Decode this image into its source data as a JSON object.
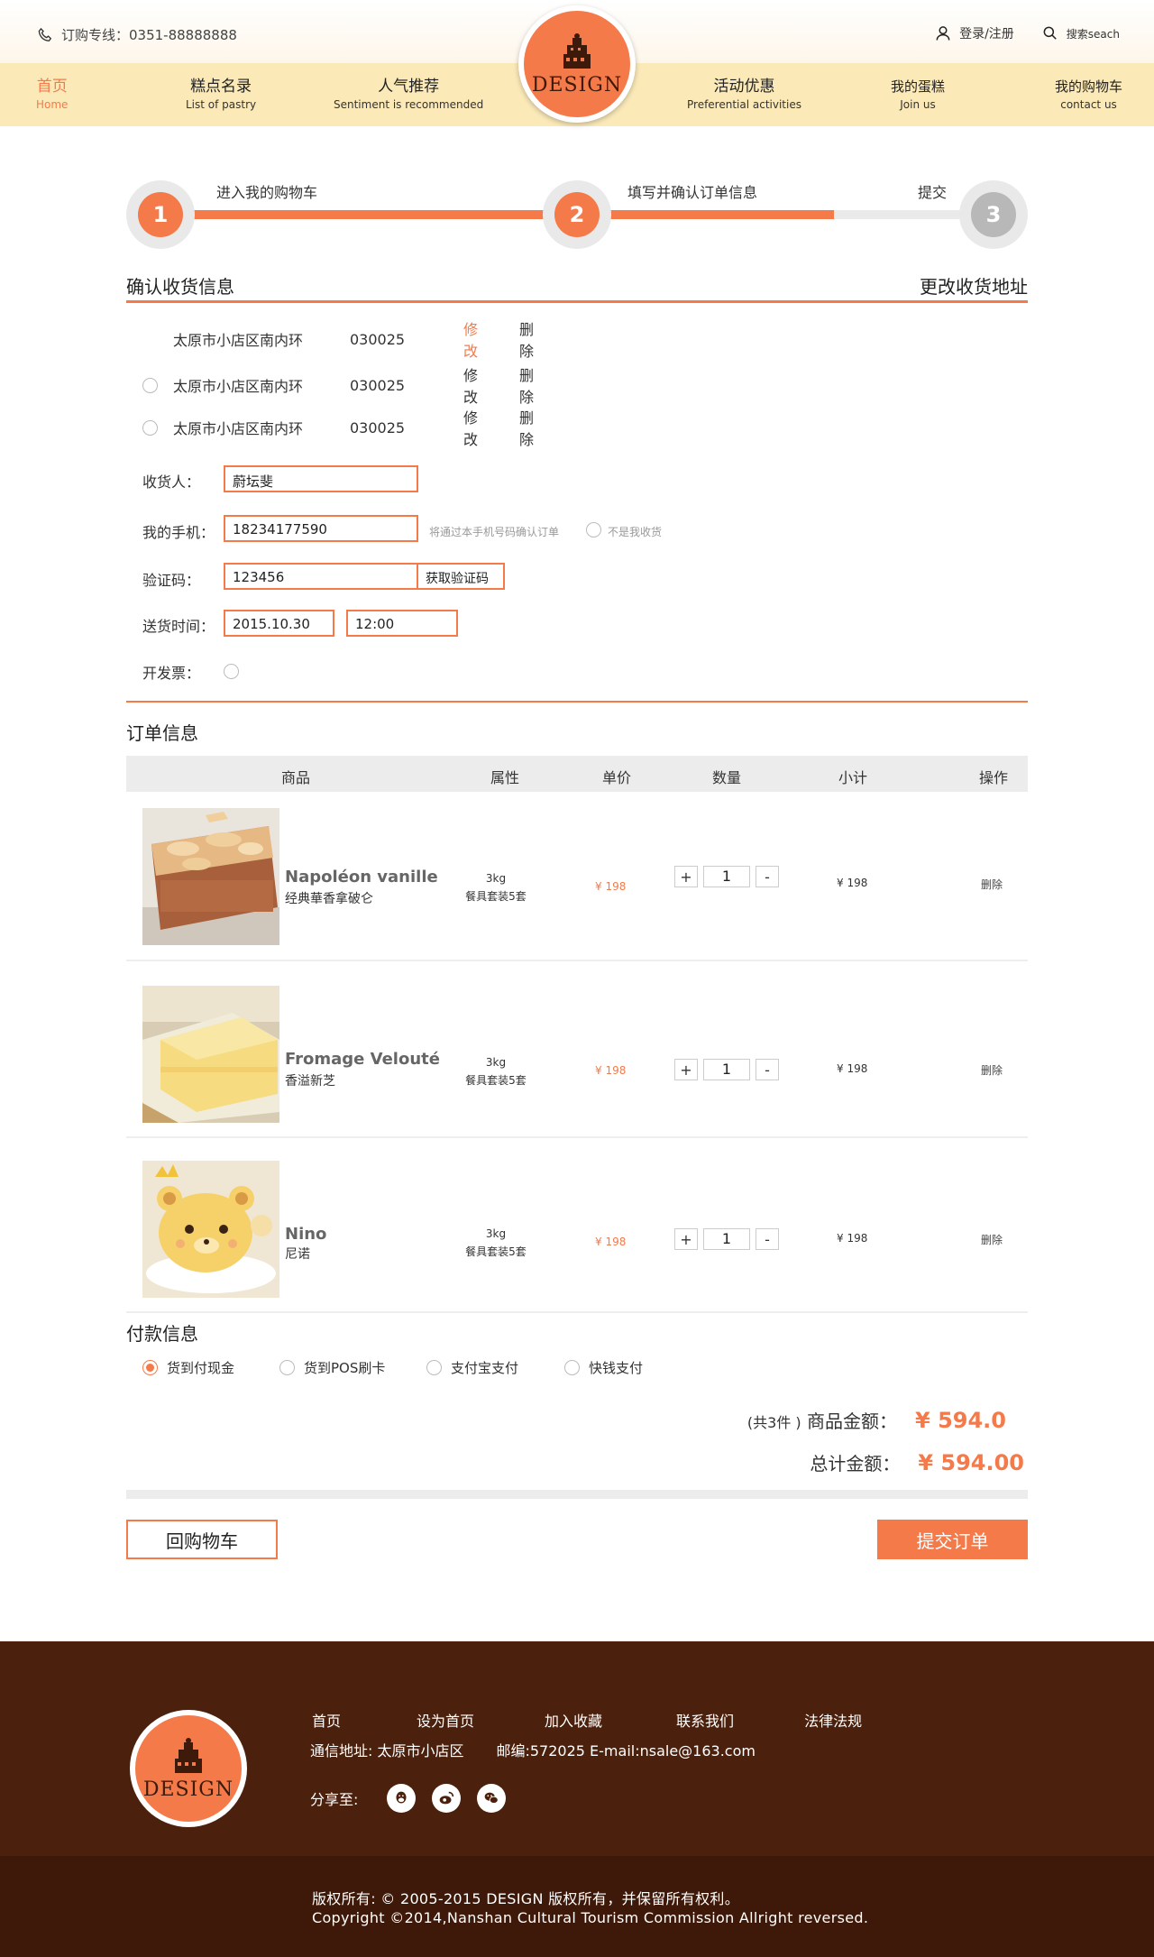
{
  "header": {
    "hotline": "订购专线：0351-88888888",
    "login_label": "登录/注册",
    "search_label": "搜索seach",
    "logo_text": "DESIGN",
    "nav": [
      {
        "cn": "首页",
        "en": "Home"
      },
      {
        "cn": "糕点名录",
        "en": "List of pastry"
      },
      {
        "cn": "人气推荐",
        "en": "Sentiment is recommended"
      },
      {
        "cn": "活动优惠",
        "en": "Preferential activities"
      },
      {
        "cn": "我的蛋糕",
        "en": "Join us"
      },
      {
        "cn": "我的购物车",
        "en": "contact us"
      }
    ]
  },
  "steps": [
    {
      "num": "1",
      "label": "进入我的购物车"
    },
    {
      "num": "2",
      "label": "填写并确认订单信息"
    },
    {
      "num": "3",
      "label": "提交"
    }
  ],
  "shipping": {
    "title": "确认收货信息",
    "change_link": "更改收货地址",
    "addresses": [
      {
        "address": "太原市小店区南内环",
        "zip": "030025",
        "edit": "修改",
        "delete": "删除"
      },
      {
        "address": "太原市小店区南内环",
        "zip": "030025",
        "edit": "修改",
        "delete": "删除"
      },
      {
        "address": "太原市小店区南内环",
        "zip": "030025",
        "edit": "修改",
        "delete": "删除"
      }
    ]
  },
  "form": {
    "receiver_label": "收货人：",
    "receiver_value": "蔚坛斐",
    "phone_label": "我的手机：",
    "phone_value": "18234177590",
    "phone_hint": "将通过本手机号码确认订单",
    "not_me_label": "不是我收货",
    "code_label": "验证码：",
    "code_value": "123456",
    "code_button": "获取验证码",
    "time_label": "送货时间：",
    "date_value": "2015.10.30",
    "time_value": "12:00",
    "invoice_label": "开发票："
  },
  "order": {
    "title": "订单信息",
    "columns": [
      "商品",
      "属性",
      "单价",
      "数量",
      "小计",
      "操作"
    ],
    "items": [
      {
        "name_en": "Napoléon vanille",
        "name_cn": "经典華香拿破仑",
        "attr_weight": "3kg",
        "attr_set": "餐具套装5套",
        "price": "¥ 198",
        "qty": "1",
        "subtotal": "¥ 198",
        "delete": "删除",
        "image": "napoleon-cake-image"
      },
      {
        "name_en": "Fromage Velouté",
        "name_cn": "香溢新芝",
        "attr_weight": "3kg",
        "attr_set": "餐具套装5套",
        "price": "¥ 198",
        "qty": "1",
        "subtotal": "¥ 198",
        "delete": "删除",
        "image": "cheese-cake-image"
      },
      {
        "name_en": "Nino",
        "name_cn": "尼诺",
        "attr_weight": "3kg",
        "attr_set": "餐具套装5套",
        "price": "¥ 198",
        "qty": "1",
        "subtotal": "¥ 198",
        "delete": "删除",
        "image": "bear-cake-image"
      }
    ]
  },
  "payment": {
    "title": "付款信息",
    "options": [
      "货到付现金",
      "货到POS刷卡",
      "支付宝支付",
      "快钱支付"
    ],
    "selected_index": 0,
    "count_text": "(共3件 )",
    "goods_label": "商品金额：",
    "goods_amount": "¥ 594.0",
    "total_label": "总计金额：",
    "total_amount": "¥ 594.00",
    "back_button": "回购物车",
    "submit_button": "提交订单"
  },
  "footer": {
    "links": [
      "首页",
      "设为首页",
      "加入收藏",
      "联系我们",
      "法律法规"
    ],
    "address": "通信地址: 太原市小店区",
    "postal": "邮编:572025 E-mail:nsale@163.com",
    "share_label": "分享至:",
    "share_icons": [
      "qq-icon",
      "weibo-icon",
      "wechat-icon"
    ],
    "copyright_cn": "版权所有: © 2005-2015 DESIGN 版权所有，并保留所有权利。",
    "copyright_en": "Copyright ©2014,Nanshan Cultural Tourism Commission Allright reversed."
  },
  "colors": {
    "accent": "#f47a4a",
    "nav_bg": "#fbe9b8",
    "footer_bg": "#4b200d"
  }
}
